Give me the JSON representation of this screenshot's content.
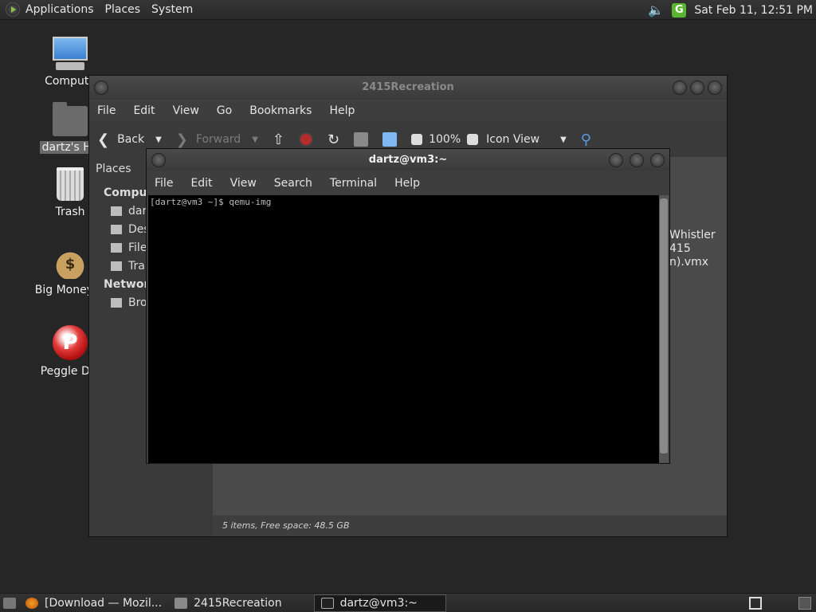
{
  "top_panel": {
    "menus": [
      "Applications",
      "Places",
      "System"
    ],
    "clock": "Sat Feb 11, 12:51 PM",
    "tray_icons": [
      "volume-icon",
      "g-icon"
    ]
  },
  "desktop": {
    "icons": [
      {
        "label": "Compute",
        "icon": "computer-icon"
      },
      {
        "label": "dartz's Ho",
        "icon": "home-folder-icon"
      },
      {
        "label": "Trash",
        "icon": "trash-icon"
      },
      {
        "label": "Big Money D",
        "icon": "money-bag-icon"
      },
      {
        "label": "Peggle Del",
        "icon": "peggle-icon"
      }
    ]
  },
  "file_manager": {
    "title": "2415Recreation",
    "menu": [
      "File",
      "Edit",
      "View",
      "Go",
      "Bookmarks",
      "Help"
    ],
    "toolbar": {
      "back": "Back",
      "forward": "Forward",
      "zoom": "100%",
      "view_mode": "Icon View"
    },
    "sidebar": {
      "header": "Places",
      "sections": [
        "Compute",
        "Network"
      ],
      "items": [
        "dar",
        "Des",
        "File",
        "Tra",
        "Bro"
      ]
    },
    "file_labels": [
      "Whistler",
      "415",
      "n).vmx"
    ],
    "status": "5 items, Free space: 48.5 GB"
  },
  "terminal": {
    "title": "dartz@vm3:~",
    "menu": [
      "File",
      "Edit",
      "View",
      "Search",
      "Terminal",
      "Help"
    ],
    "lines": [
      "[dartz@vm3 ~]$ qemu-img"
    ]
  },
  "bottom_panel": {
    "tasks": [
      {
        "label": "[Download — Mozil...",
        "icon": "firefox-icon"
      },
      {
        "label": "2415Recreation",
        "icon": "folder-icon"
      },
      {
        "label": "dartz@vm3:~",
        "icon": "terminal-icon"
      }
    ]
  }
}
